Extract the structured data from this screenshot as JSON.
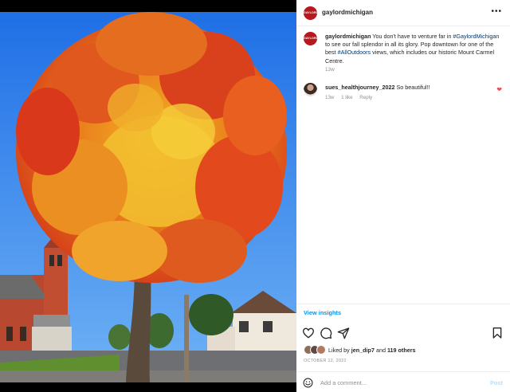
{
  "post": {
    "username": "gaylordmichigan",
    "avatar_text": "GAYLORD",
    "more_icon": "more-horizontal-icon",
    "caption": {
      "part1": "You don't have to venture far in ",
      "tag1": "#GaylordMichigan",
      "part2": " to see our fall splendor in all its glory. Pop downtown for one of the best ",
      "tag2": "#AllOutdoors",
      "part3": " views, which includes our historic Mount Carmel Centre.",
      "time": "13w"
    },
    "comments": [
      {
        "username": "sues_healthjourney_2022",
        "text": "So beautiful!!",
        "time": "13w",
        "likes": "1 like",
        "reply_label": "Reply",
        "heart_icon": "heart-filled-icon"
      }
    ],
    "view_insights": "View insights",
    "likes": {
      "prefix": "Liked by",
      "user": "jen_dip7",
      "connector": "and",
      "others": "119 others"
    },
    "date": "OCTOBER 12, 2022",
    "add_comment_placeholder": "Add a comment...",
    "post_button": "Post"
  },
  "colors": {
    "accent_blue": "#0095f6",
    "heart_red": "#ed4956",
    "brand_red": "#b3191f",
    "post_disabled": "#b2dffc"
  }
}
